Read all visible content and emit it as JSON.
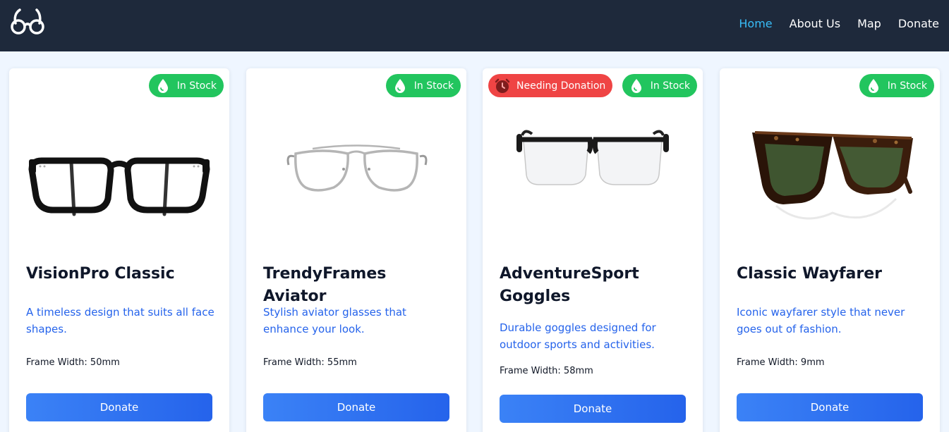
{
  "nav": {
    "logo_icon": "glasses-logo-icon",
    "links": [
      {
        "label": "Home",
        "active": true
      },
      {
        "label": "About Us",
        "active": false
      },
      {
        "label": "Map",
        "active": false
      },
      {
        "label": "Donate",
        "active": false
      }
    ]
  },
  "colors": {
    "navbar": "#1e293b",
    "active_link": "#38bdf8",
    "in_stock": "#22c55e",
    "needing_donation": "#ef4444",
    "description": "#2563eb",
    "button": "#3b82f6"
  },
  "products": [
    {
      "name": "VisionPro Classic",
      "description": "A timeless design that suits all face shapes.",
      "frame_width": "Frame Width: 50mm",
      "badges": [
        {
          "label": "In Stock",
          "type": "in-stock",
          "icon": "droplet-icon"
        }
      ],
      "image_icon": "black-square-glasses-icon",
      "button": "Donate"
    },
    {
      "name": "TrendyFrames Aviator",
      "description": "Stylish aviator glasses that enhance your look.",
      "frame_width": "Frame Width: 55mm",
      "badges": [
        {
          "label": "In Stock",
          "type": "in-stock",
          "icon": "droplet-icon"
        }
      ],
      "image_icon": "silver-aviator-glasses-icon",
      "button": "Donate"
    },
    {
      "name": "AdventureSport Goggles",
      "description": "Durable goggles designed for outdoor sports and activities.",
      "frame_width": "Frame Width: 58mm",
      "badges": [
        {
          "label": "Needing Donation",
          "type": "needing-donation",
          "icon": "alarm-clock-icon"
        },
        {
          "label": "In Stock",
          "type": "in-stock",
          "icon": "droplet-icon"
        }
      ],
      "image_icon": "half-rim-glasses-icon",
      "button": "Donate"
    },
    {
      "name": "Classic Wayfarer",
      "description": "Iconic wayfarer style that never goes out of fashion.",
      "frame_width": "Frame Width: 9mm",
      "badges": [
        {
          "label": "In Stock",
          "type": "in-stock",
          "icon": "droplet-icon"
        }
      ],
      "image_icon": "tortoise-wayfarer-sunglasses-icon",
      "button": "Donate"
    }
  ]
}
